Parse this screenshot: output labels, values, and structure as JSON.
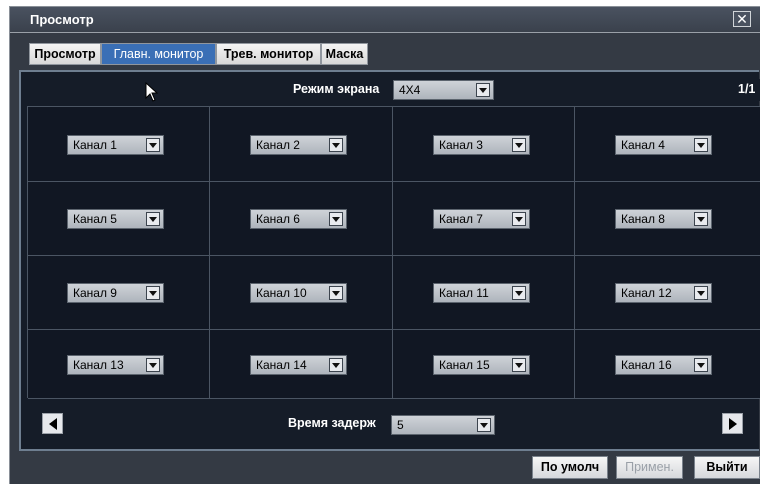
{
  "window": {
    "title": "Просмотр"
  },
  "tabs": [
    {
      "label": "Просмотр",
      "active": false
    },
    {
      "label": "Главн. монитор",
      "active": true
    },
    {
      "label": "Трев. монитор",
      "active": false
    },
    {
      "label": "Маска",
      "active": false
    }
  ],
  "screen_mode": {
    "label": "Режим экрана",
    "value": "4X4"
  },
  "page_indicator": "1/1",
  "channels": [
    "Канал 1",
    "Канал 2",
    "Канал 3",
    "Канал 4",
    "Канал 5",
    "Канал 6",
    "Канал 7",
    "Канал 8",
    "Канал 9",
    "Канал 10",
    "Канал 11",
    "Канал 12",
    "Канал 13",
    "Канал 14",
    "Канал 15",
    "Канал 16"
  ],
  "dwell": {
    "label": "Время задерж",
    "value": "5"
  },
  "buttons": {
    "default": "По умолч",
    "apply": "Примен.",
    "exit": "Выйти"
  },
  "colors": {
    "accent_tab": "#3a6fb6",
    "background": "#151c28",
    "window": "#343a44"
  }
}
